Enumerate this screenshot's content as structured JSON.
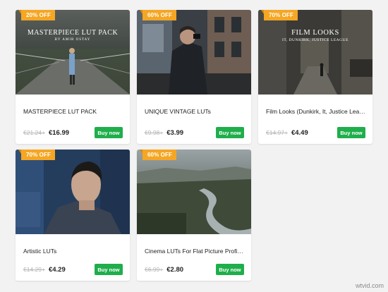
{
  "products": [
    {
      "badge": "20% OFF",
      "image_text": [
        "MASTERPIECE LUT PACK",
        "BY AMIR OSTAY"
      ],
      "title": "MASTERPIECE LUT PACK",
      "old_price": "€21.24+",
      "new_price": "€16.99",
      "buy_label": "Buy now"
    },
    {
      "badge": "60% OFF",
      "title": "UNIQUE VINTAGE LUTs",
      "old_price": "€9.98+",
      "new_price": "€3.99",
      "buy_label": "Buy now"
    },
    {
      "badge": "70% OFF",
      "image_text": [
        "FILM LOOKS",
        "IT, DUNKIRK, JUSTICE LEAGUE"
      ],
      "title": "Film Looks (Dunkirk, It, Justice Leag...",
      "old_price": "€14.97+",
      "new_price": "€4.49",
      "buy_label": "Buy now"
    },
    {
      "badge": "70% OFF",
      "title": "Artistic LUTs",
      "old_price": "€14.29+",
      "new_price": "€4.29",
      "buy_label": "Buy now"
    },
    {
      "badge": "60% OFF",
      "title": "Cinema LUTs For Flat Picture Profiles",
      "old_price": "€6.99+",
      "new_price": "€2.80",
      "buy_label": "Buy now"
    }
  ],
  "watermark": "wtvid.com",
  "colors": {
    "badge": "#f5a623",
    "buy_button": "#1fae4b",
    "background": "#f2f2f2"
  }
}
